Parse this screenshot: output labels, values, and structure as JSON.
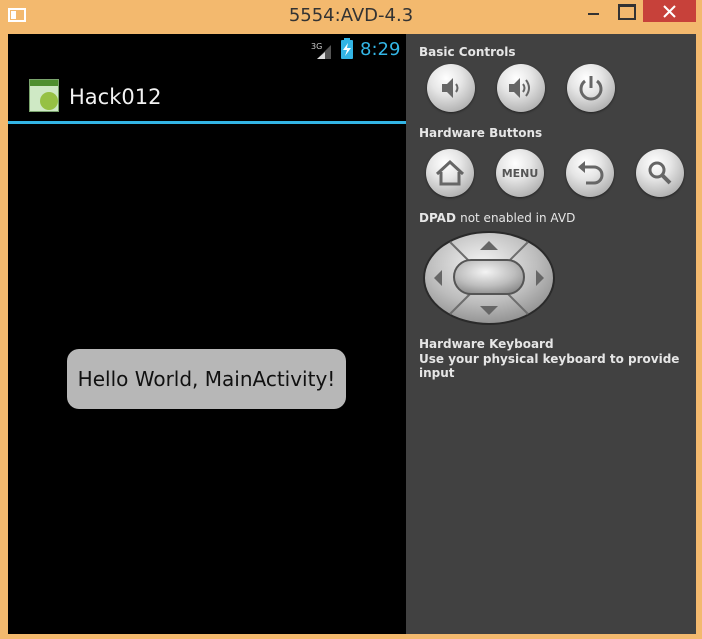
{
  "window": {
    "title": "5554:AVD-4.3"
  },
  "status_bar": {
    "network": "3G",
    "time": "8:29"
  },
  "action_bar": {
    "app_title": "Hack012"
  },
  "toast": {
    "text": "Hello World, MainActivity!"
  },
  "controls": {
    "basic_label": "Basic Controls",
    "hardware_label": "Hardware Buttons",
    "menu_label": "MENU",
    "dpad_label": "DPAD",
    "dpad_note": "not enabled in AVD",
    "keyboard_title": "Hardware Keyboard",
    "keyboard_desc": "Use your physical keyboard to provide input"
  },
  "colors": {
    "accent": "#33b5e5",
    "frame": "#f3b96e",
    "panel": "#414141",
    "close": "#c7413a"
  }
}
